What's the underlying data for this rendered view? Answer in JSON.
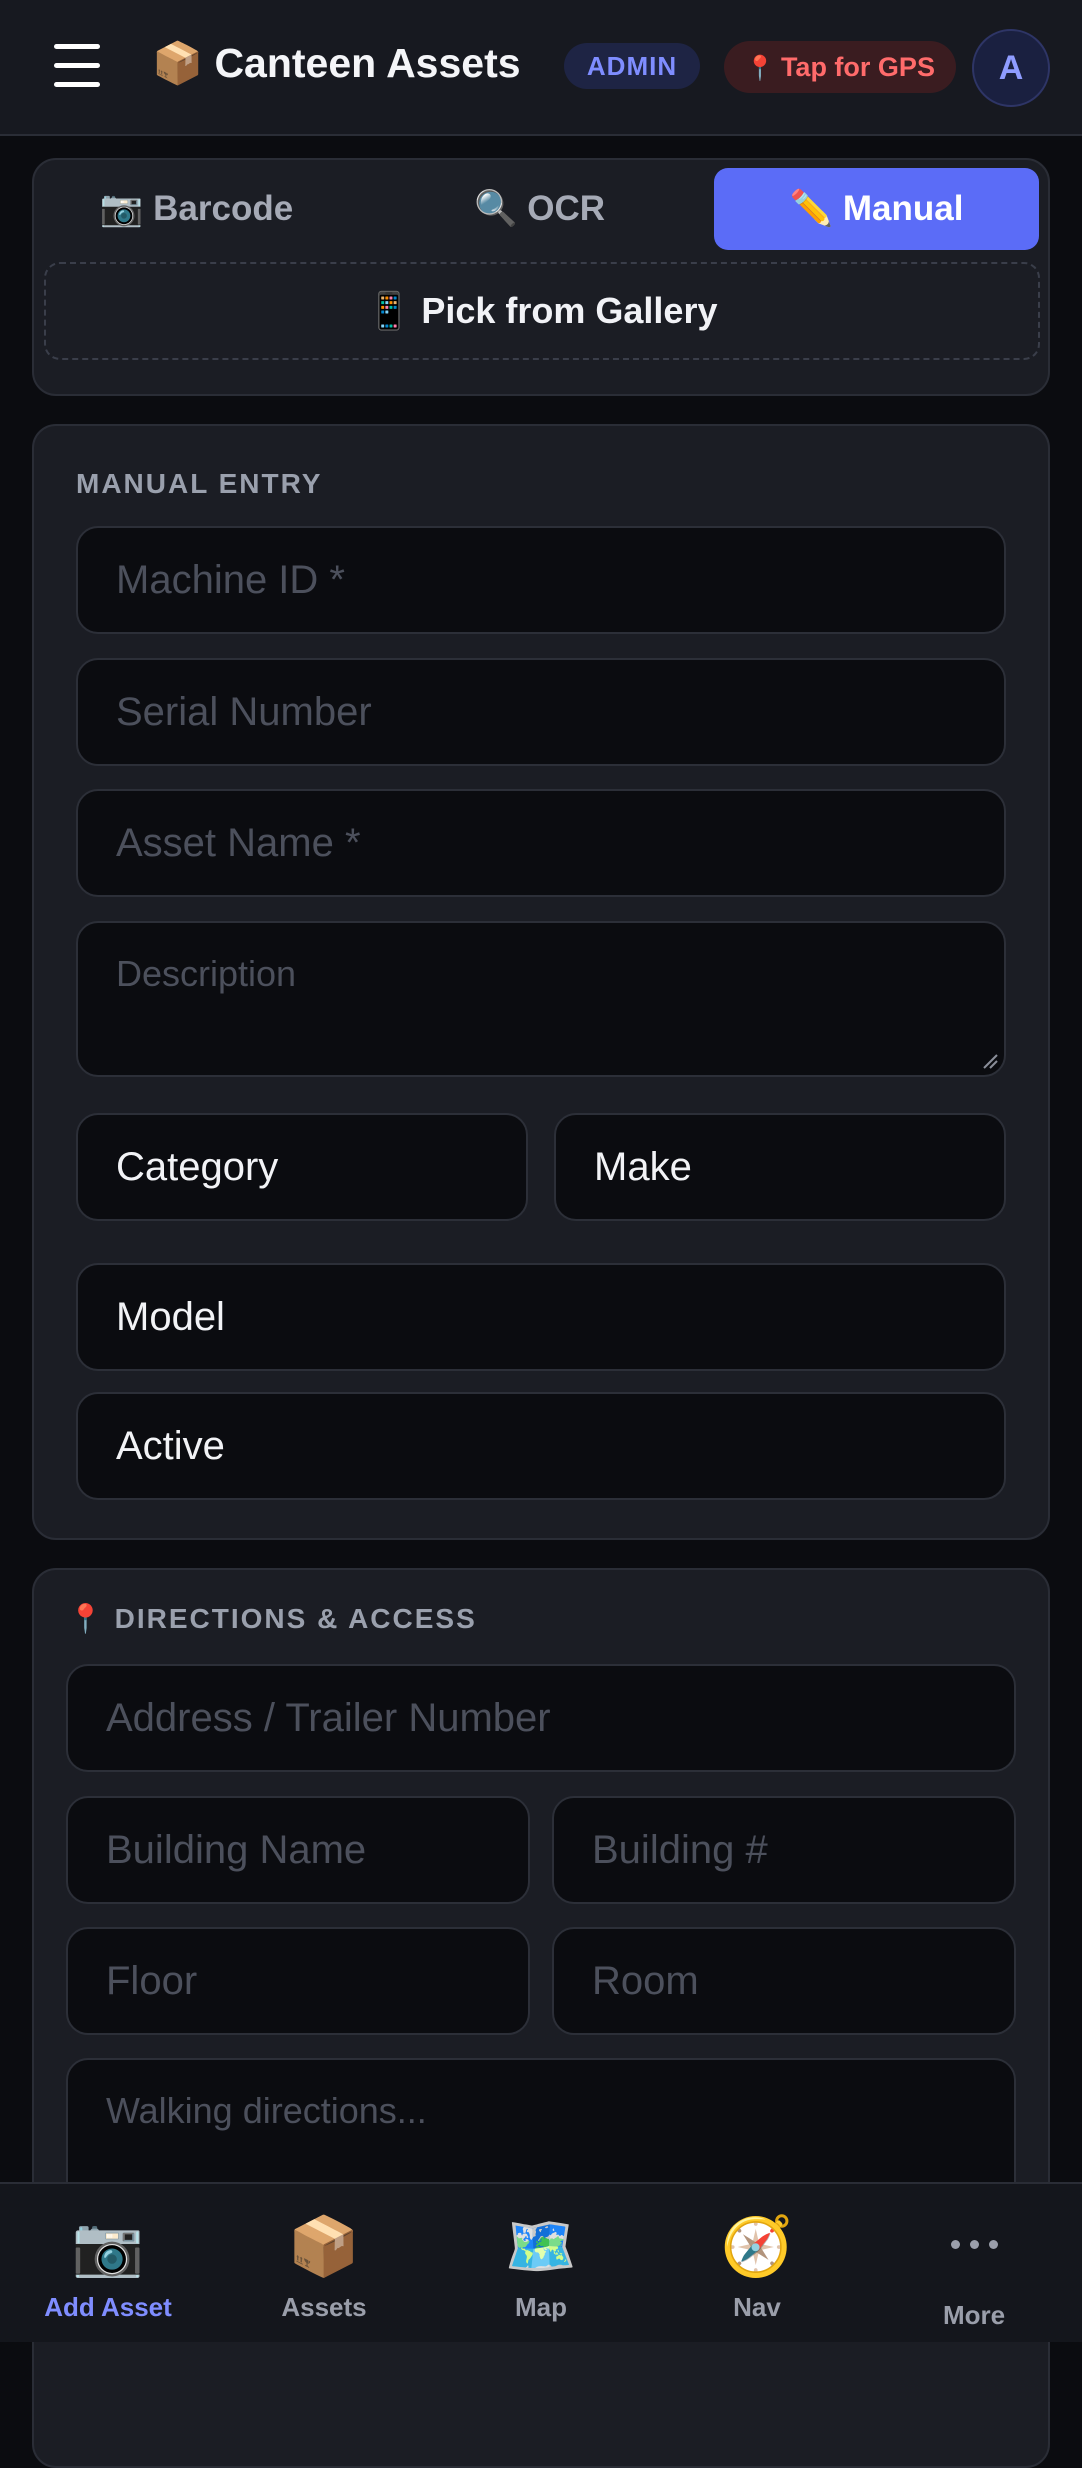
{
  "header": {
    "title": "📦 Canteen Assets",
    "role_badge": "ADMIN",
    "gps_label": "Tap for GPS",
    "gps_icon": "📍",
    "avatar_initial": "A"
  },
  "scan": {
    "tabs": [
      {
        "label": "📷 Barcode"
      },
      {
        "label": "🔍 OCR"
      },
      {
        "label": "✏️ Manual"
      }
    ],
    "active_tab": "Manual",
    "gallery_label": "📱 Pick from Gallery"
  },
  "manual_entry": {
    "section_title": "MANUAL ENTRY",
    "machine_id_placeholder": "Machine ID *",
    "serial_placeholder": "Serial Number",
    "asset_name_placeholder": "Asset Name *",
    "description_placeholder": "Description",
    "category_value": "Category",
    "make_value": "Make",
    "model_value": "Model",
    "status_value": "Active"
  },
  "directions": {
    "section_icon": "📍",
    "section_title": "DIRECTIONS & ACCESS",
    "address_placeholder": "Address / Trailer Number",
    "building_name_placeholder": "Building Name",
    "building_num_placeholder": "Building #",
    "floor_placeholder": "Floor",
    "room_placeholder": "Room",
    "walking_placeholder": "Walking directions..."
  },
  "bottom_nav": {
    "items": [
      {
        "icon": "📷",
        "label": "Add Asset"
      },
      {
        "icon": "📦",
        "label": "Assets"
      },
      {
        "icon": "🗺️",
        "label": "Map"
      },
      {
        "icon": "🧭",
        "label": "Nav"
      },
      {
        "icon": "more-dots-icon",
        "label": "More"
      }
    ],
    "active": "Add Asset"
  },
  "colors": {
    "accent": "#5b6cf7",
    "background": "#0b0c10",
    "card": "#1b1d24",
    "gps_red": "#ff6b6b"
  }
}
